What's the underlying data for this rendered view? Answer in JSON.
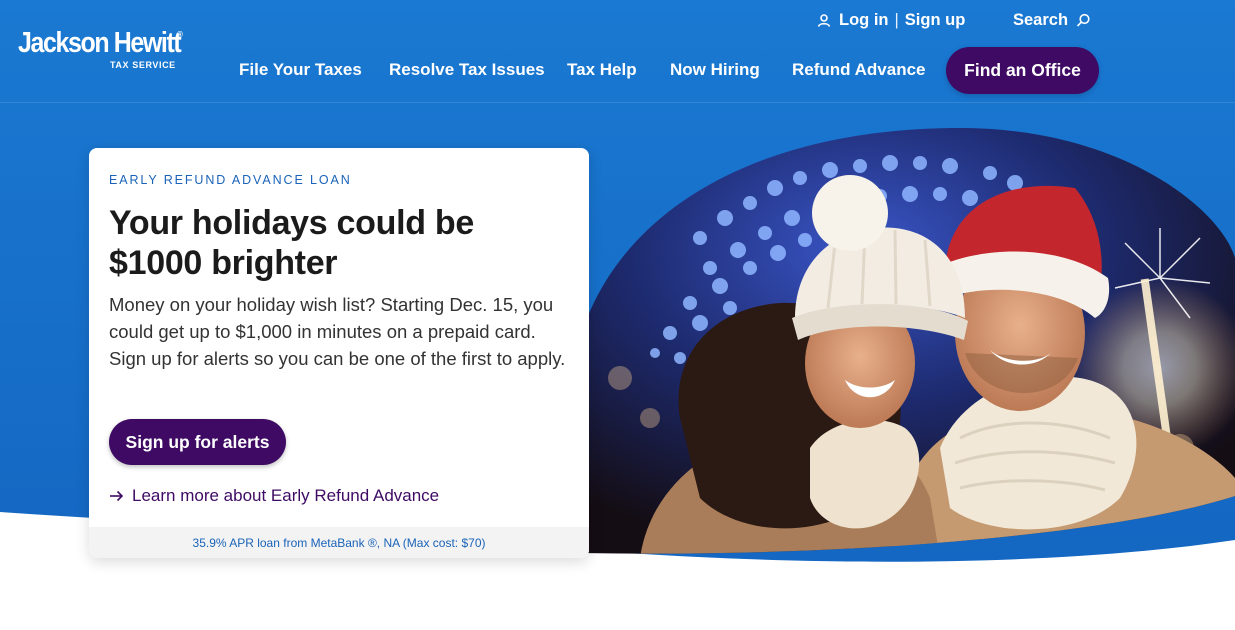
{
  "brand": {
    "name": "Jackson Hewitt",
    "tagline": "TAX SERVICE",
    "registered_mark": "®"
  },
  "colors": {
    "primary_blue": "#1875cf",
    "accent_purple": "#3e0a63",
    "link_blue": "#1a63b8"
  },
  "header": {
    "login_label": "Log in",
    "separator": "|",
    "signup_label": "Sign up",
    "search_label": "Search",
    "user_icon": "user-icon",
    "search_icon": "search-icon",
    "nav": [
      {
        "label": "File Your Taxes"
      },
      {
        "label": "Resolve Tax Issues"
      },
      {
        "label": "Tax Help"
      },
      {
        "label": "Now Hiring"
      },
      {
        "label": "Refund Advance"
      }
    ],
    "cta_label": "Find an Office"
  },
  "hero": {
    "eyebrow": "EARLY REFUND ADVANCE LOAN",
    "headline": "Your holidays could be $1000 brighter",
    "body": "Money on your holiday wish list? Starting Dec. 15, you could get up to $1,000 in minutes on a prepaid card. Sign up for alerts so you can be one of the first to apply.",
    "button_label": "Sign up for alerts",
    "link_label": "Learn more about Early Refund Advance",
    "link_icon": "arrow-right-icon",
    "disclaimer": "35.9% APR loan from MetaBank ®, NA (Max cost: $70)",
    "photo_icon": "holiday-couple-photo"
  }
}
